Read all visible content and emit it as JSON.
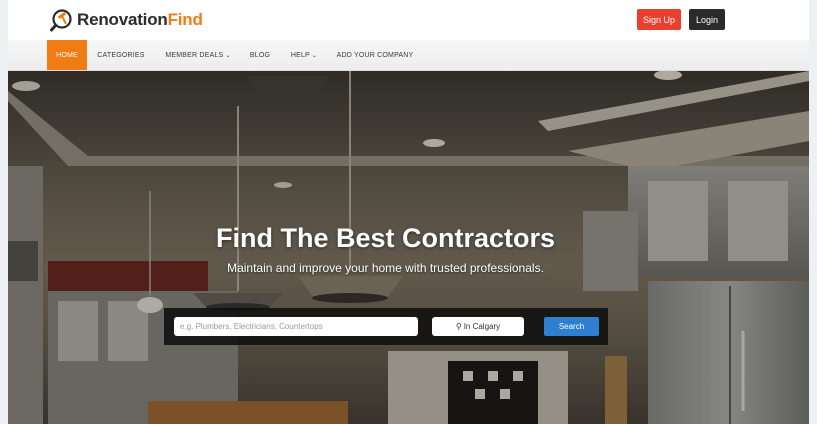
{
  "brand": {
    "name_part1": "Renovation",
    "name_part2": "Find",
    "accent": "#f07c13"
  },
  "header": {
    "signup_label": "Sign Up",
    "login_label": "Login"
  },
  "nav": {
    "items": [
      {
        "label": "HOME",
        "active": true
      },
      {
        "label": "CATEGORIES"
      },
      {
        "label": "MEMBER DEALS",
        "dropdown": true
      },
      {
        "label": "BLOG"
      },
      {
        "label": "HELP",
        "dropdown": true
      },
      {
        "label": "ADD YOUR COMPANY"
      }
    ]
  },
  "hero": {
    "title": "Find The Best Contractors",
    "subtitle": "Maintain and improve your home with trusted professionals."
  },
  "search": {
    "placeholder": "e.g. Plumbers, Electricians, Countertops",
    "location_label": "In Calgary",
    "button_label": "Search"
  },
  "colors": {
    "signup": "#ea3f2e",
    "login": "#2b2b2b",
    "search_button": "#2f7fd0"
  }
}
